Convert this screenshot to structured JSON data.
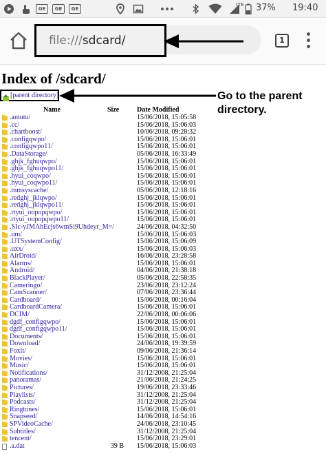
{
  "status_bar": {
    "left_icons": [
      "play-icon",
      "touch-icon",
      "ge-badge-icon",
      "ge-badge-icon",
      "ge-badge-icon",
      "location-icon",
      "image-icon",
      "more-dots-icon"
    ],
    "right_icons": [
      "bluetooth-icon",
      "wifi-icon",
      "signal-icon",
      "battery-icon"
    ],
    "ge_label": "GE",
    "network": "LTE",
    "battery": "37%",
    "time": "19:40"
  },
  "browser": {
    "url_scheme": "file:///",
    "url_path": "sdcard/",
    "tab_count": "1"
  },
  "page": {
    "title": "Index of /sdcard/",
    "parent_link": "[parent directory]",
    "columns": {
      "name": "Name",
      "size": "Size",
      "date": "Date Modified"
    }
  },
  "annotation": "Go to the parent directory.",
  "entries": [
    {
      "name": ".antutu/",
      "size": "",
      "date": "15/06/2018, 15:05:58",
      "type": "folder"
    },
    {
      "name": ".cc/",
      "size": "",
      "date": "15/06/2018, 15:06:03",
      "type": "folder"
    },
    {
      "name": ".chartboost/",
      "size": "",
      "date": "10/06/2018, 09:28:32",
      "type": "folder"
    },
    {
      "name": ".configqwpo/",
      "size": "",
      "date": "15/06/2018, 15:06:01",
      "type": "folder"
    },
    {
      "name": ".configqwpo11/",
      "size": "",
      "date": "15/06/2018, 15:06:01",
      "type": "folder"
    },
    {
      "name": ".DataStorage/",
      "size": "",
      "date": "05/06/2018, 16:33:49",
      "type": "folder"
    },
    {
      "name": ".ghjk_fghuqwpo/",
      "size": "",
      "date": "15/06/2018, 15:06:01",
      "type": "folder"
    },
    {
      "name": ".ghjk_fghuqwpo11/",
      "size": "",
      "date": "15/06/2018, 15:06:01",
      "type": "folder"
    },
    {
      "name": ".hyui_coqwpo/",
      "size": "",
      "date": "15/06/2018, 15:06:01",
      "type": "folder"
    },
    {
      "name": ".hyui_coqwpo11/",
      "size": "",
      "date": "15/06/2018, 15:06:01",
      "type": "folder"
    },
    {
      "name": ".mmsyscache/",
      "size": "",
      "date": "05/06/2018, 12:18:16",
      "type": "folder"
    },
    {
      "name": ".redghj_jklqwpo/",
      "size": "",
      "date": "15/06/2018, 15:06:01",
      "type": "folder"
    },
    {
      "name": ".redghj_jklqwpo11/",
      "size": "",
      "date": "15/06/2018, 15:06:01",
      "type": "folder"
    },
    {
      "name": ".rtyui_oopopqwpo/",
      "size": "",
      "date": "15/06/2018, 15:06:01",
      "type": "folder"
    },
    {
      "name": ".rtyui_oopopqwpo11/",
      "size": "",
      "date": "15/06/2018, 15:06:01",
      "type": "folder"
    },
    {
      "name": ".SIc-yJMAhEcjs6wmSi9Uhdeyr_M=/",
      "size": "",
      "date": "24/06/2018, 04:32:50",
      "type": "folder"
    },
    {
      "name": ".um/",
      "size": "",
      "date": "15/06/2018, 15:06:03",
      "type": "folder"
    },
    {
      "name": ".UTSystemConfig/",
      "size": "",
      "date": "15/06/2018, 15:06:09",
      "type": "folder"
    },
    {
      "name": ".uxx/",
      "size": "",
      "date": "15/06/2018, 15:06:03",
      "type": "folder"
    },
    {
      "name": "AirDroid/",
      "size": "",
      "date": "16/06/2018, 23:28:58",
      "type": "folder"
    },
    {
      "name": "Alarms/",
      "size": "",
      "date": "15/06/2018, 15:06:01",
      "type": "folder"
    },
    {
      "name": "Android/",
      "size": "",
      "date": "04/06/2018, 21:38:18",
      "type": "folder"
    },
    {
      "name": "BlackPlayer/",
      "size": "",
      "date": "05/06/2018, 22:58:35",
      "type": "folder"
    },
    {
      "name": "Cameringo/",
      "size": "",
      "date": "23/06/2018, 23:12:24",
      "type": "folder"
    },
    {
      "name": "CamScanner/",
      "size": "",
      "date": "07/06/2018, 23:36:44",
      "type": "folder"
    },
    {
      "name": "Cardboard/",
      "size": "",
      "date": "15/06/2018, 00:16:04",
      "type": "folder"
    },
    {
      "name": "CardboardCamera/",
      "size": "",
      "date": "15/06/2018, 15:06:01",
      "type": "folder"
    },
    {
      "name": "DCIM/",
      "size": "",
      "date": "22/06/2018, 00:06:06",
      "type": "folder"
    },
    {
      "name": "dgdf_configqwpo/",
      "size": "",
      "date": "15/06/2018, 15:06:01",
      "type": "folder"
    },
    {
      "name": "dgdf_configqwpo11/",
      "size": "",
      "date": "15/06/2018, 15:06:01",
      "type": "folder"
    },
    {
      "name": "Documents/",
      "size": "",
      "date": "15/06/2018, 15:06:01",
      "type": "folder"
    },
    {
      "name": "Download/",
      "size": "",
      "date": "24/06/2018, 19:39:59",
      "type": "folder"
    },
    {
      "name": "Foxit/",
      "size": "",
      "date": "09/06/2018, 21:36:14",
      "type": "folder"
    },
    {
      "name": "Movies/",
      "size": "",
      "date": "15/06/2018, 15:06:01",
      "type": "folder"
    },
    {
      "name": "Music/",
      "size": "",
      "date": "15/06/2018, 15:06:01",
      "type": "folder"
    },
    {
      "name": "Notifications/",
      "size": "",
      "date": "31/12/2008, 21:25:04",
      "type": "folder"
    },
    {
      "name": "panoramas/",
      "size": "",
      "date": "21/06/2018, 21:24:25",
      "type": "folder"
    },
    {
      "name": "Pictures/",
      "size": "",
      "date": "19/06/2018, 23:33:46",
      "type": "folder"
    },
    {
      "name": "Playlists/",
      "size": "",
      "date": "31/12/2008, 21:25:04",
      "type": "folder"
    },
    {
      "name": "Podcasts/",
      "size": "",
      "date": "31/12/2008, 21:25:04",
      "type": "folder"
    },
    {
      "name": "Ringtones/",
      "size": "",
      "date": "15/06/2018, 15:06:01",
      "type": "folder"
    },
    {
      "name": "Snapseed/",
      "size": "",
      "date": "14/06/2018, 14:54:16",
      "type": "folder"
    },
    {
      "name": "SPVideoCache/",
      "size": "",
      "date": "24/06/2018, 23:10:45",
      "type": "folder"
    },
    {
      "name": "Subtitles/",
      "size": "",
      "date": "31/12/2008, 21:25:04",
      "type": "folder"
    },
    {
      "name": "tencent/",
      "size": "",
      "date": "15/06/2018, 23:29:01",
      "type": "folder"
    },
    {
      "name": ".a.dat",
      "size": "39 B",
      "date": "15/06/2018, 15:06:03",
      "type": "file"
    }
  ],
  "colors": {
    "link": "#2a1fa0",
    "folder": "#f0c040",
    "status_bar_bg": "#f2f2f2",
    "annotation_ink": "#000000"
  }
}
